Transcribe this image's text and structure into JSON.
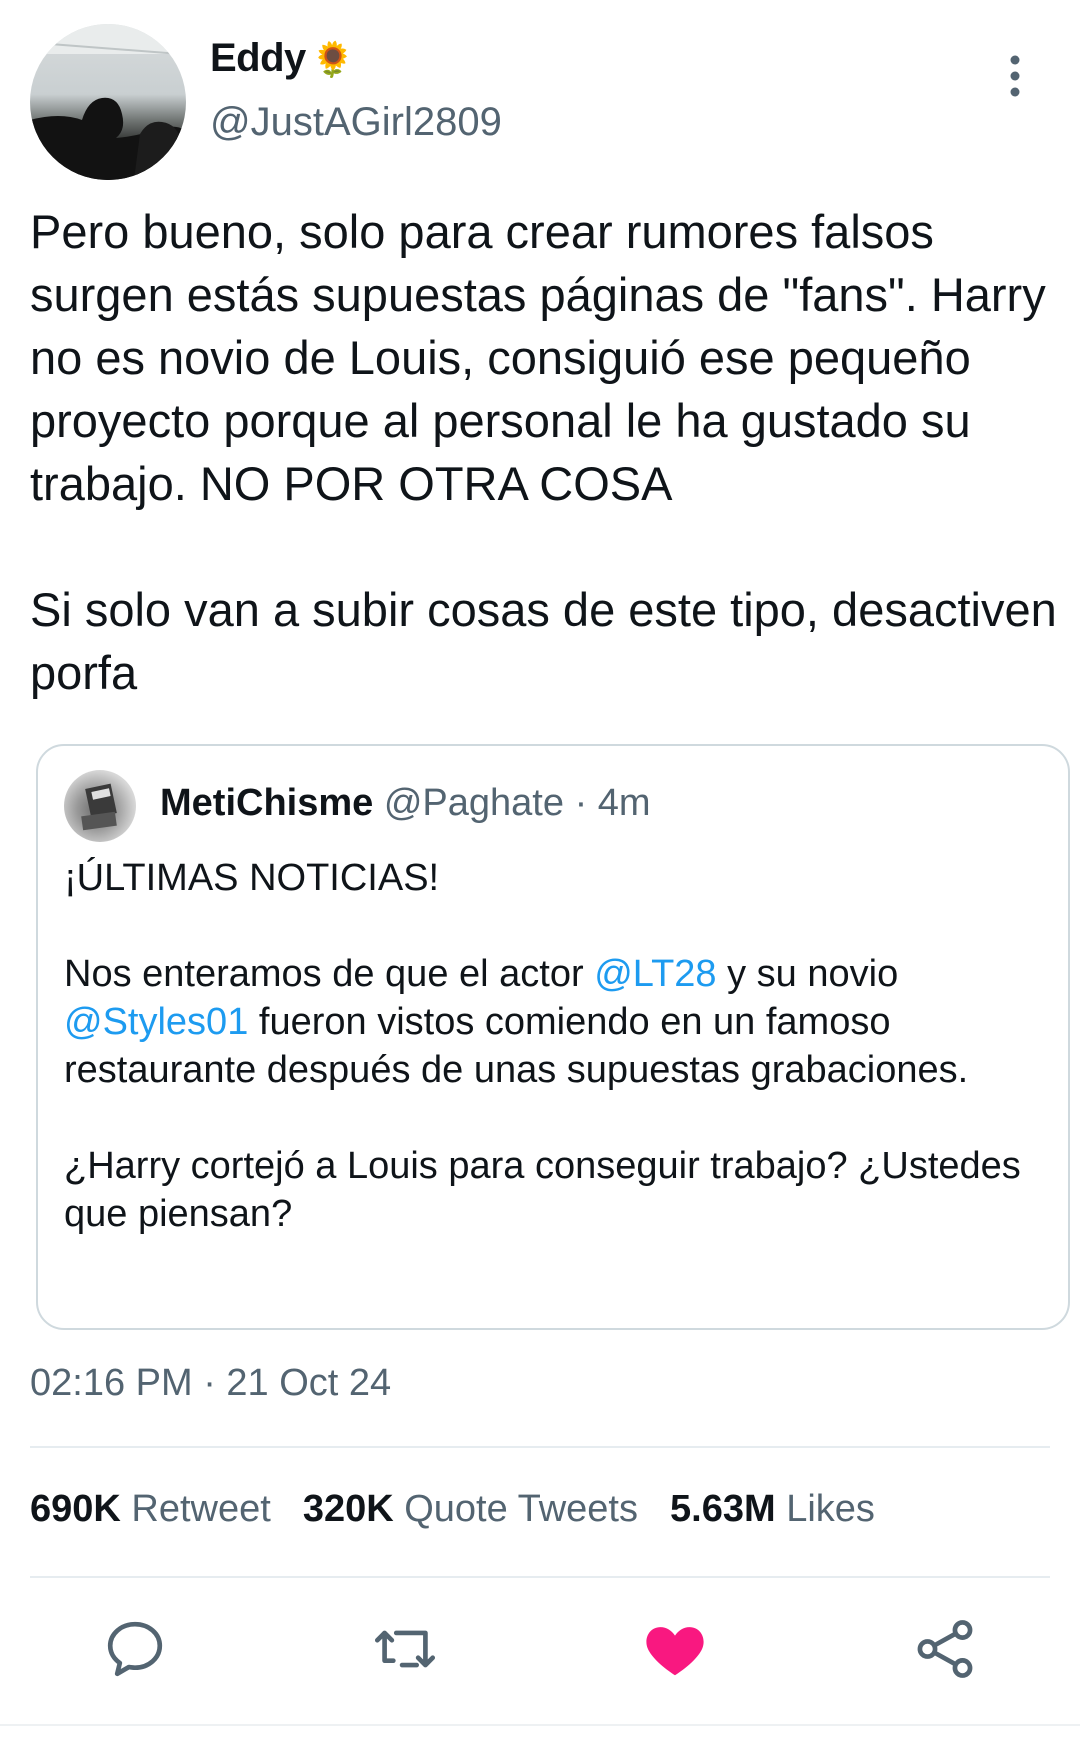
{
  "author": {
    "display_name": "Eddy",
    "emoji": "🌻",
    "handle": "@JustAGirl2809"
  },
  "tweet": {
    "text": "Pero bueno, solo para crear rumores falsos surgen estás supuestas páginas de \"fans\". Harry no es novio de Louis, consiguió ese pequeño proyecto porque al personal le ha gustado su trabajo. NO POR OTRA COSA\n\nSi solo van a subir cosas de este tipo, desactiven porfa",
    "timestamp": "02:16 PM · 21 Oct 24"
  },
  "quote": {
    "name": "MetiChisme",
    "handle": "@Paghate",
    "separator": "·",
    "time": "4m",
    "headline": "¡ÚLTIMAS NOTICIAS!",
    "p2_a": "Nos enteramos de que el actor ",
    "mention_1": "@LT28",
    "p2_b": " y su novio ",
    "mention_2": "@Styles01",
    "p2_c": " fueron vistos comiendo en un famoso restaurante después de unas supuestas grabaciones.",
    "p3": "¿Harry cortejó a Louis para conseguir trabajo? ¿Ustedes que piensan?"
  },
  "stats": {
    "retweets_count": "690K",
    "retweets_label": "Retweet",
    "quotes_count": "320K",
    "quotes_label": "Quote Tweets",
    "likes_count": "5.63M",
    "likes_label": "Likes"
  },
  "icons": {
    "more": "more-vertical-icon",
    "reply": "reply-icon",
    "retweet": "retweet-icon",
    "like": "heart-icon",
    "share": "share-icon"
  },
  "colors": {
    "accent": "#1d9bf0",
    "like_active": "#f91880",
    "secondary_text": "#536471",
    "border": "#cfd9de"
  }
}
